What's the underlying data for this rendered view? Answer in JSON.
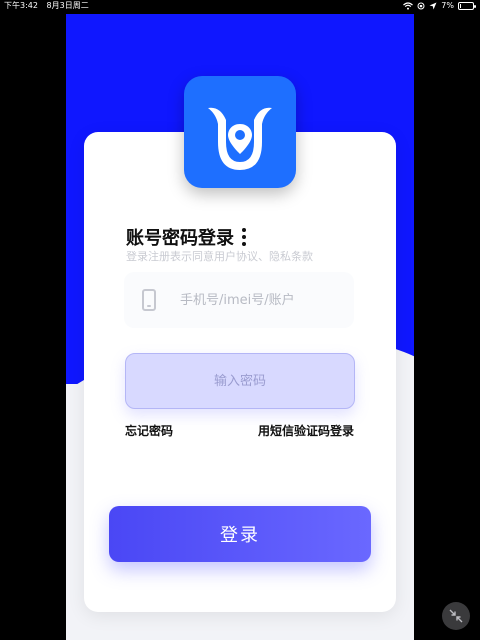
{
  "status_bar": {
    "time": "下午3:42",
    "date": "8月3日周二",
    "battery": "7%",
    "battery_level": 0.07
  },
  "colors": {
    "hero_blue": "#0f17ff",
    "logo_blue": "#1e6fff",
    "button_blue": "#5856ff"
  },
  "login": {
    "title": "账号密码登录",
    "subtitle": "登录注册表示同意用户协议、隐私条款",
    "phone_placeholder": "手机号/imei号/账户",
    "password_placeholder": "输入密码",
    "forgot_password": "忘记密码",
    "sms_login": "用短信验证码登录",
    "login_button": "登录"
  },
  "icons": {
    "logo": "location-pin-logo-icon",
    "phone": "phone-icon",
    "more": "more-vertical-icon",
    "collapse": "collapse-arrows-icon"
  }
}
